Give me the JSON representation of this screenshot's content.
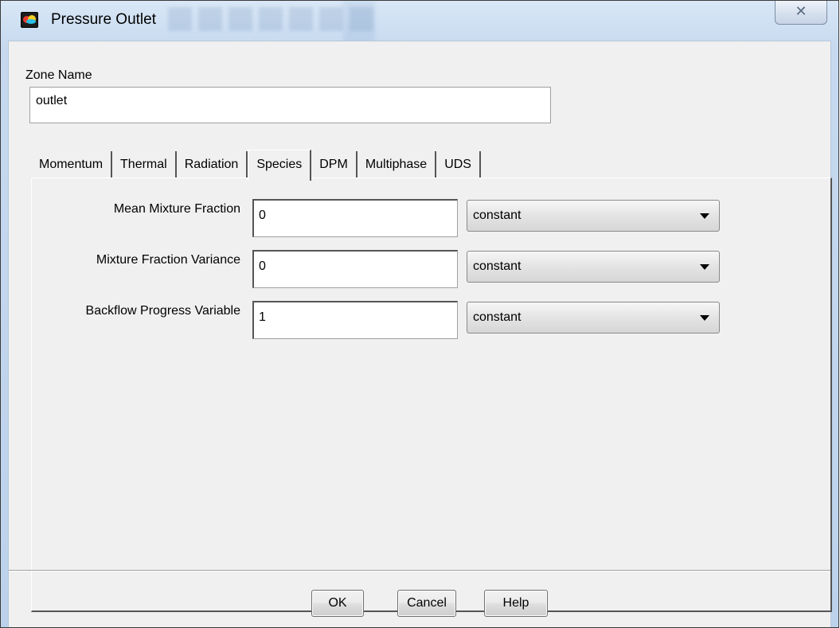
{
  "window": {
    "title": "Pressure Outlet",
    "close_glyph": "✕"
  },
  "zone": {
    "label": "Zone Name",
    "value": "outlet"
  },
  "tabs": [
    {
      "label": "Momentum",
      "active": false
    },
    {
      "label": "Thermal",
      "active": false
    },
    {
      "label": "Radiation",
      "active": false
    },
    {
      "label": "Species",
      "active": true
    },
    {
      "label": "DPM",
      "active": false
    },
    {
      "label": "Multiphase",
      "active": false
    },
    {
      "label": "UDS",
      "active": false
    }
  ],
  "species": {
    "rows": [
      {
        "label": "Mean Mixture Fraction",
        "value": "0",
        "method": "constant"
      },
      {
        "label": "Mixture Fraction Variance",
        "value": "0",
        "method": "constant"
      },
      {
        "label": "Backflow Progress Variable",
        "value": "1",
        "method": "constant"
      }
    ]
  },
  "buttons": {
    "ok": "OK",
    "cancel": "Cancel",
    "help": "Help"
  },
  "icons": {
    "app": "fluent-app-icon",
    "close": "close-icon",
    "dropdown": "chevron-down-icon"
  }
}
